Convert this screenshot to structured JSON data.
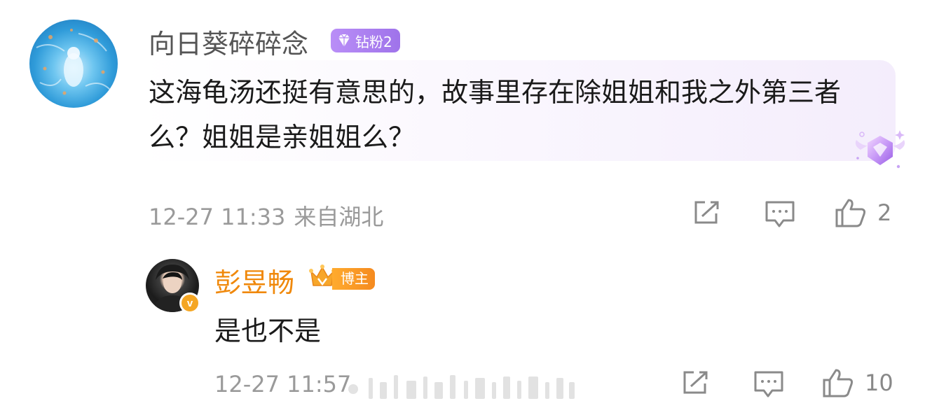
{
  "comment": {
    "username": "向日葵碎碎念",
    "fan_badge": "钻粉2",
    "text": "这海龟汤还挺有意思的，故事里存在除姐姐和我之外第三者么？姐姐是亲姐姐么？",
    "time": "12-27 11:33",
    "location": "来自湖北",
    "like_count": "2",
    "icons": [
      "share-icon",
      "reply-icon",
      "like-icon"
    ]
  },
  "reply": {
    "username": "彭昱畅",
    "role_badge": "博主",
    "verified_mark": "v",
    "text": "是也不是",
    "time": "12-27 11:57",
    "like_count": "10",
    "icons": [
      "share-icon",
      "reply-icon",
      "like-icon"
    ]
  },
  "colors": {
    "reply_username": "#f0880a",
    "fan_badge": "#a87cf0",
    "meta_text": "#9a9a9a"
  }
}
